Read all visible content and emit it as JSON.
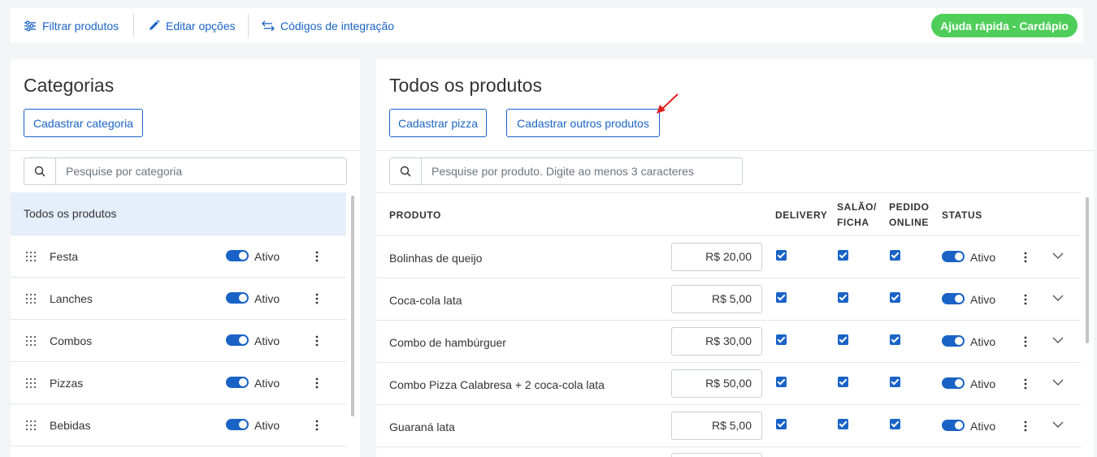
{
  "topbar": {
    "filter_label": "Filtrar produtos",
    "edit_label": "Editar opções",
    "codes_label": "Códigos de integração",
    "help_label": "Ajuda rápida - Cardápio"
  },
  "categories": {
    "title": "Categorias",
    "add_button": "Cadastrar categoria",
    "search_placeholder": "Pesquise por categoria",
    "all_label": "Todos os produtos",
    "items": [
      {
        "name": "Festa",
        "status": "Ativo"
      },
      {
        "name": "Lanches",
        "status": "Ativo"
      },
      {
        "name": "Combos",
        "status": "Ativo"
      },
      {
        "name": "Pizzas",
        "status": "Ativo"
      },
      {
        "name": "Bebidas",
        "status": "Ativo"
      }
    ]
  },
  "products": {
    "title": "Todos os produtos",
    "add_pizza_button": "Cadastrar pizza",
    "add_other_button": "Cadastrar outros produtos",
    "search_placeholder": "Pesquise por produto. Digite ao menos 3 caracteres",
    "columns": {
      "product": "PRODUTO",
      "delivery": "DELIVERY",
      "salao_1": "SALÃO/",
      "salao_2": "FICHA",
      "online_1": "PEDIDO",
      "online_2": "ONLINE",
      "status": "STATUS"
    },
    "rows": [
      {
        "name": "Bolinhas de queijo",
        "price": "R$ 20,00",
        "status": "Ativo"
      },
      {
        "name": "Coca-cola lata",
        "price": "R$ 5,00",
        "status": "Ativo"
      },
      {
        "name": "Combo de hambúrguer",
        "price": "R$ 30,00",
        "status": "Ativo"
      },
      {
        "name": "Combo Pizza Calabresa + 2 coca-cola lata",
        "price": "R$ 50,00",
        "status": "Ativo"
      },
      {
        "name": "Guaraná lata",
        "price": "R$ 5,00",
        "status": "Ativo"
      }
    ]
  },
  "colors": {
    "accent": "#1a63c6",
    "help_green": "#4fce5a",
    "selected_bg": "#e5effc",
    "annotation_arrow": "#e02020"
  }
}
